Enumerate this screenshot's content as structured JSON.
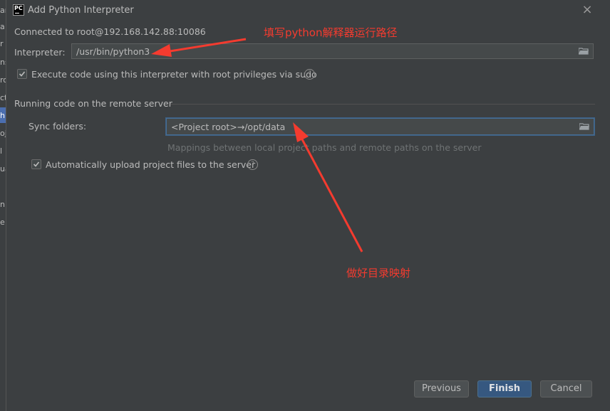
{
  "window": {
    "title": "Add Python Interpreter",
    "logo_text": "PC"
  },
  "sidebar_fragments": [
    "ar",
    "a",
    "r",
    "ns",
    "ro",
    "ct",
    "h",
    "oje",
    "l",
    "ua",
    "n",
    "e"
  ],
  "connection": {
    "text": "Connected to root@192.168.142.88:10086"
  },
  "interpreter": {
    "label": "Interpreter:",
    "value": "/usr/bin/python3"
  },
  "sudo_option": {
    "label": "Execute code using this interpreter with root privileges via sudo",
    "checked": true
  },
  "remote_section": {
    "title": "Running code on the remote server",
    "sync_label": "Sync folders:",
    "sync_value": "<Project root>→/opt/data",
    "sync_hint": "Mappings between local project paths and remote paths on the server",
    "upload_label": "Automatically upload project files to the server",
    "upload_checked": true
  },
  "buttons": {
    "previous": "Previous",
    "finish": "Finish",
    "cancel": "Cancel"
  },
  "annotations": {
    "interpreter_note": "填写python解释器运行路径",
    "mapping_note": "做好目录映射",
    "color": "#f43b2f"
  },
  "colors": {
    "background": "#3c3f41",
    "field": "#45494a",
    "primary_button": "#365880",
    "focus_border": "#466d94"
  }
}
